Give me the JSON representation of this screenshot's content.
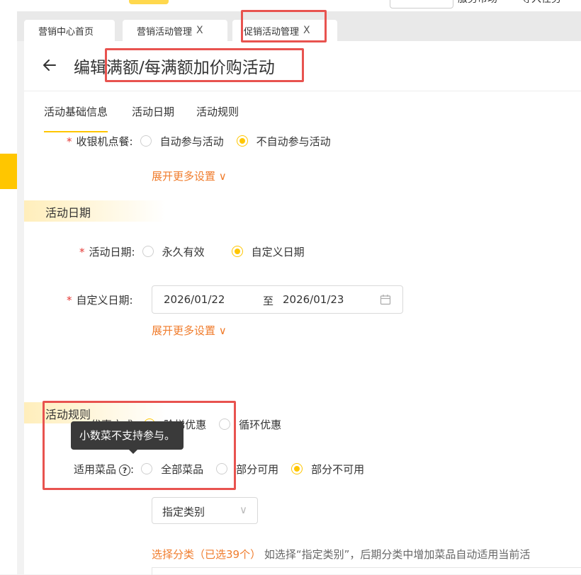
{
  "top_nav": {
    "partial_left": "—",
    "partial_right_1": "服务市场",
    "partial_right_2": "导入任务"
  },
  "tabs": [
    {
      "label": "营销中心首页",
      "closable": false
    },
    {
      "label": "营销活动管理",
      "closable": true
    },
    {
      "label": "促销活动管理",
      "closable": true
    }
  ],
  "close_glyph": "X",
  "header": {
    "title_prefix": "编辑",
    "title_rest": "满额/每满额加价购活动"
  },
  "subtabs": [
    "活动基础信息",
    "活动日期",
    "活动规则"
  ],
  "cashier": {
    "label": "收银机点餐",
    "options": [
      "自动参与活动",
      "不自动参与活动"
    ],
    "selected": 1
  },
  "more_settings": "展开更多设置",
  "section_dates": "活动日期",
  "activity_date": {
    "label": "活动日期",
    "options": [
      "永久有效",
      "自定义日期"
    ],
    "selected": 1
  },
  "custom_date": {
    "label": "自定义日期",
    "start": "2026/01/22",
    "separator": "至",
    "end": "2026/01/23"
  },
  "section_rules": "活动规则",
  "discount_mode": {
    "label": "优惠方式",
    "options": [
      "阶梯优惠",
      "循环优惠"
    ],
    "selected": 0
  },
  "tooltip": "小数菜不支持参与。",
  "applicable_dishes": {
    "label": "适用菜品",
    "options": [
      "全部菜品",
      "部分可用",
      "部分不可用"
    ],
    "selected": 2
  },
  "category_select": {
    "value": "指定类别"
  },
  "category_hint": {
    "link": "选择分类（已选39个）",
    "text": "如选择“指定类别”，后期分类中增加菜品自动适用当前活"
  },
  "colors": {
    "accent": "#ffc600",
    "link_orange": "#f07c2c",
    "required_red": "#e53935",
    "highlight_red": "#e8534f"
  }
}
